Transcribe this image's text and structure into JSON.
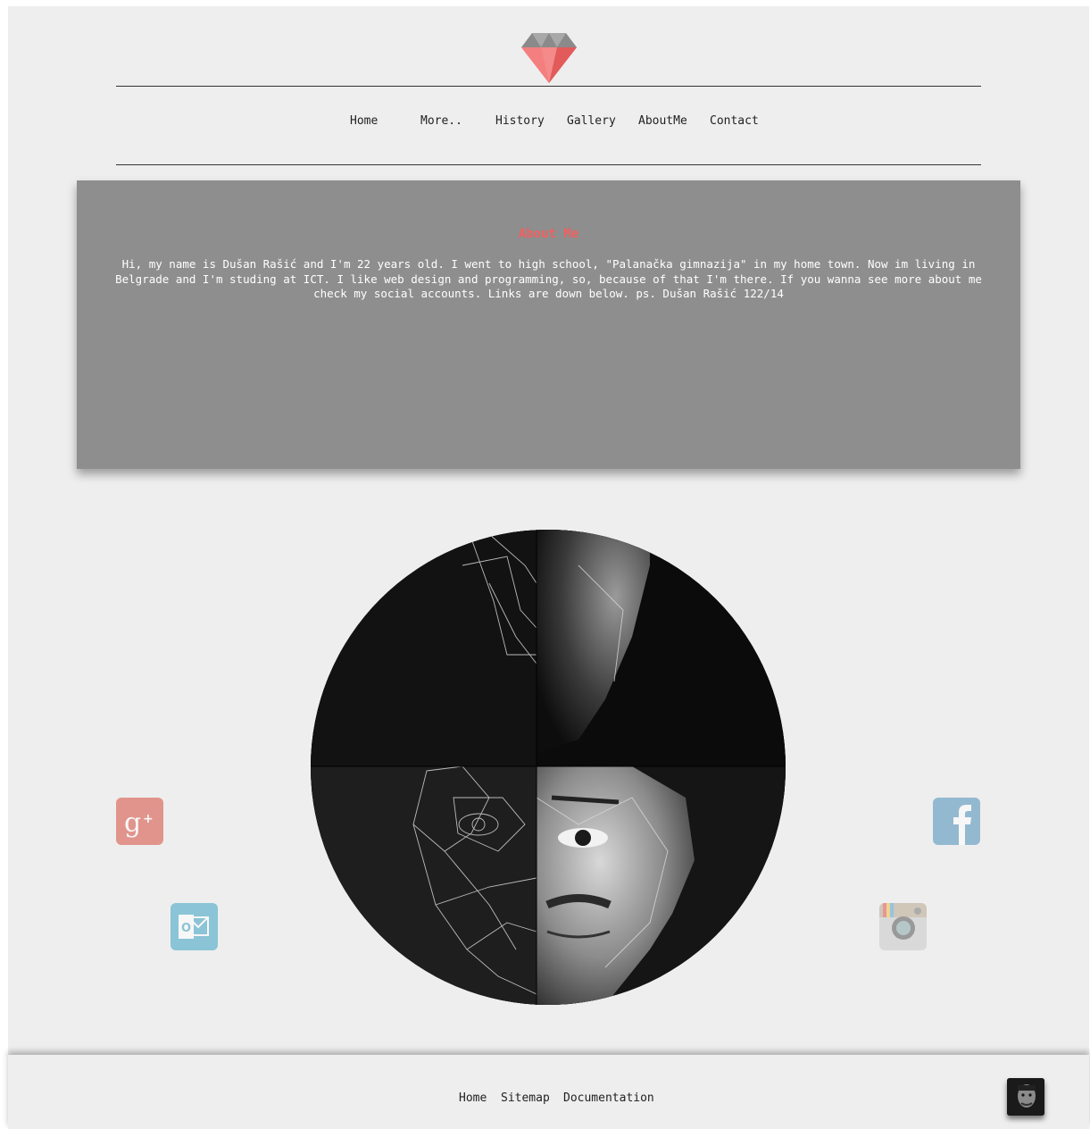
{
  "nav": {
    "home": "Home",
    "more": "More..",
    "history": "History",
    "gallery": "Gallery",
    "aboutme": "AboutMe",
    "contact": "Contact"
  },
  "about": {
    "title": "About Me",
    "text": "Hi, my name is Dušan Rašić and I'm 22 years old. I went to high school, \"Palanačka gimnazija\" in my home town. Now im living in Belgrade and I'm studing at ICT. I like web design and programming, so, because of that I'm there. If you wanna see more about me check my social accounts. Links are down below. ps. Dušan Rašić 122/14"
  },
  "footer": {
    "home": "Home",
    "sitemap": "Sitemap",
    "documentation": "Documentation"
  },
  "icons": {
    "logo": "diamond-icon",
    "google_plus": "google-plus-icon",
    "outlook": "outlook-icon",
    "facebook": "facebook-icon",
    "instagram": "instagram-icon"
  },
  "colors": {
    "accent": "#f06060",
    "about_bg": "#8e8e8e",
    "page_bg": "#eeeeee"
  }
}
